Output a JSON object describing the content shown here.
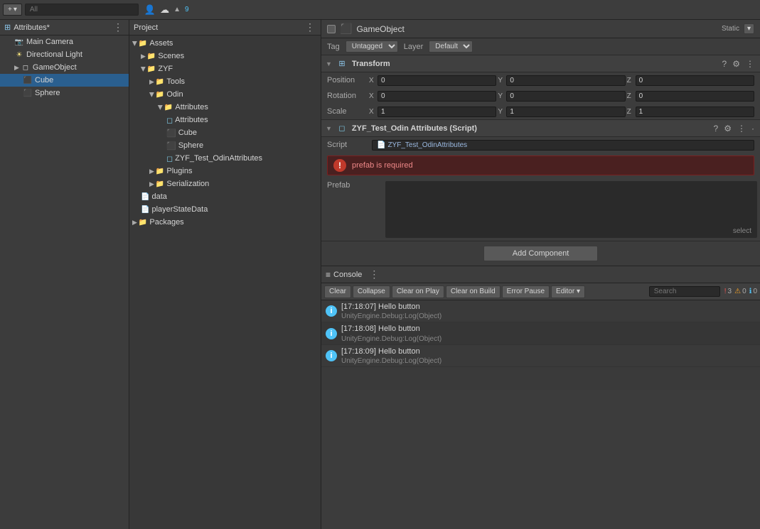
{
  "toolbar": {
    "search_placeholder": "All",
    "add_label": "+",
    "asset_count": "9"
  },
  "hierarchy": {
    "title": "Attributes*",
    "items": [
      {
        "label": "Main Camera",
        "indent": 1,
        "icon": "camera"
      },
      {
        "label": "Directional Light",
        "indent": 1,
        "icon": "light"
      },
      {
        "label": "GameObject",
        "indent": 1,
        "icon": "go"
      },
      {
        "label": "Cube",
        "indent": 2,
        "icon": "cube",
        "selected": true
      },
      {
        "label": "Sphere",
        "indent": 2,
        "icon": "cube"
      }
    ]
  },
  "project": {
    "title": "Project",
    "items": [
      {
        "label": "Assets",
        "type": "folder",
        "indent": 0,
        "open": true
      },
      {
        "label": "Scenes",
        "type": "folder",
        "indent": 1,
        "open": false
      },
      {
        "label": "ZYF",
        "type": "folder",
        "indent": 1,
        "open": true
      },
      {
        "label": "Tools",
        "type": "folder",
        "indent": 2,
        "open": false
      },
      {
        "label": "Odin",
        "type": "folder",
        "indent": 2,
        "open": true
      },
      {
        "label": "Attributes",
        "type": "folder",
        "indent": 3,
        "open": true
      },
      {
        "label": "Attributes",
        "type": "script",
        "indent": 4
      },
      {
        "label": "Cube",
        "type": "prefab",
        "indent": 4
      },
      {
        "label": "Sphere",
        "type": "prefab",
        "indent": 4
      },
      {
        "label": "ZYF_Test_OdinAttributes",
        "type": "script",
        "indent": 4
      },
      {
        "label": "Plugins",
        "type": "folder",
        "indent": 2,
        "open": false
      },
      {
        "label": "Serialization",
        "type": "folder",
        "indent": 2,
        "open": false
      },
      {
        "label": "data",
        "type": "file",
        "indent": 1
      },
      {
        "label": "playerStateData",
        "type": "file",
        "indent": 1
      },
      {
        "label": "Packages",
        "type": "folder",
        "indent": 0,
        "open": false
      }
    ]
  },
  "inspector": {
    "go_name": "GameObject",
    "static_label": "Static",
    "tag_label": "Tag",
    "tag_value": "Untagged",
    "layer_label": "Layer",
    "layer_value": "Default",
    "transform": {
      "title": "Transform",
      "position": {
        "label": "Position",
        "x": "0",
        "y": "0",
        "z": "0"
      },
      "rotation": {
        "label": "Rotation",
        "x": "0",
        "y": "0",
        "z": "0"
      },
      "scale": {
        "label": "Scale",
        "x": "1",
        "y": "1",
        "z": "1"
      }
    },
    "script_component": {
      "title": "ZYF_Test_Odin Attributes (Script)",
      "script_label": "Script",
      "script_value": "ZYF_Test_OdinAttributes",
      "error_text": "prefab is required",
      "prefab_label": "Prefab"
    },
    "add_component_label": "Add Component"
  },
  "console": {
    "title": "Console",
    "buttons": {
      "clear": "Clear",
      "collapse": "Collapse",
      "clear_on_play": "Clear on Play",
      "clear_on_build": "Clear on Build",
      "error_pause": "Error Pause",
      "editor": "Editor"
    },
    "counts": {
      "errors": "3",
      "warnings": "0",
      "info": "0"
    },
    "logs": [
      {
        "time": "[17:18:07]",
        "message": "Hello button",
        "sub": "UnityEngine.Debug:Log(Object)"
      },
      {
        "time": "[17:18:08]",
        "message": "Hello button",
        "sub": "UnityEngine.Debug:Log(Object)"
      },
      {
        "time": "[17:18:09]",
        "message": "Hello button",
        "sub": "UnityEngine.Debug:Log(Object)"
      }
    ]
  }
}
